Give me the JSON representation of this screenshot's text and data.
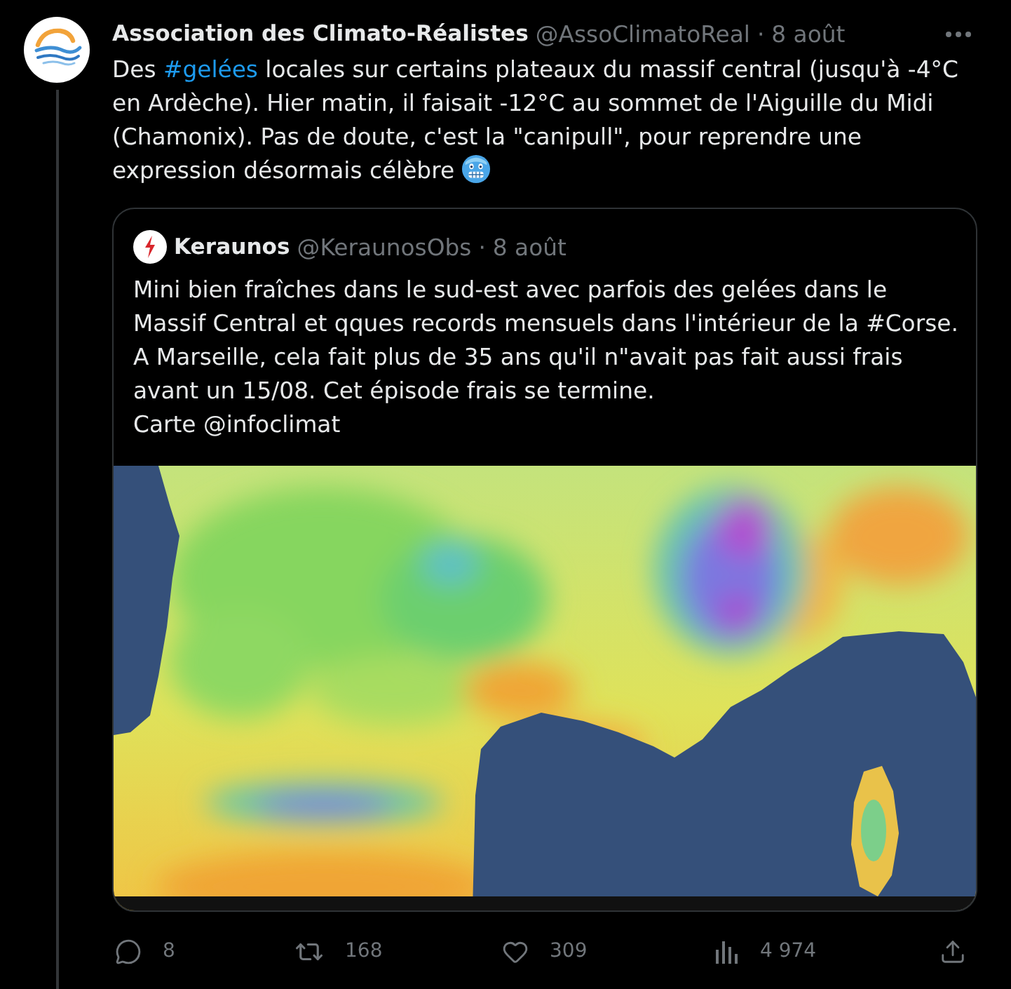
{
  "tweet": {
    "author": {
      "name": "Association des Climato-Réalistes",
      "handle": "@AssoClimatoReal",
      "separator": "·",
      "date": "8 août"
    },
    "text": [
      {
        "kind": "plain",
        "text": "Des "
      },
      {
        "kind": "hashtag",
        "text": "#gelées"
      },
      {
        "kind": "plain",
        "text": " locales sur certains plateaux du massif central (jusqu'à -4°C en Ardèche). Hier matin, il faisait -12°C au sommet de l'Aiguille du Midi (Chamonix). Pas de doute, c'est la \"canipull\", pour reprendre une expression désormais célèbre "
      }
    ],
    "quote": {
      "author": {
        "name": "Keraunos",
        "handle": "@KeraunosObs",
        "separator": "·",
        "date": "8 août"
      },
      "text": "Mini bien fraîches dans le sud-est avec parfois des gelées dans le Massif Central et qques records mensuels dans l'intérieur de la #Corse. A Marseille, cela fait plus de 35 ans qu'il n\"avait pas fait aussi frais avant un 15/08. Cet épisode frais se termine.\nCarte @infoclimat"
    },
    "actions": [
      {
        "kind": "reply",
        "count": "8"
      },
      {
        "kind": "retweet",
        "count": "168"
      },
      {
        "kind": "like",
        "count": "309"
      },
      {
        "kind": "views",
        "count": "4 974"
      },
      {
        "kind": "share"
      }
    ]
  }
}
